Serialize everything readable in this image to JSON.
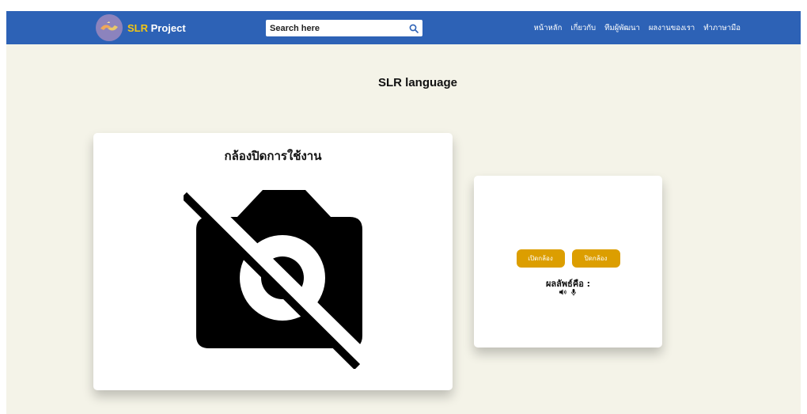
{
  "navbar": {
    "brand": {
      "highlight": "SLR",
      "rest": " Project",
      "logo_icon": "hands-sign-logo"
    },
    "search": {
      "placeholder": "Search here",
      "icon": "search-icon"
    },
    "links": [
      {
        "label": "หน้าหลัก"
      },
      {
        "label": "เกี่ยวกับ"
      },
      {
        "label": "ทีมผู้พัฒนา"
      },
      {
        "label": "ผลงานของเรา"
      },
      {
        "label": "ทำภาษามือ"
      }
    ]
  },
  "main": {
    "title": "SLR language",
    "camera": {
      "status": "กล้องปิดการใช้งาน",
      "icon": "camera-off-icon"
    },
    "controls": {
      "open_camera": "เปิดกล้อง",
      "close_camera": "ปิดกล้อง",
      "result_label": "ผลลัพธ์คือ :",
      "icons": [
        "speaker-icon",
        "microphone-icon"
      ]
    }
  },
  "colors": {
    "navbar": "#2d62b6",
    "brand_accent": "#f3c613",
    "background": "#f4f3e8",
    "button": "#dc9e00"
  }
}
